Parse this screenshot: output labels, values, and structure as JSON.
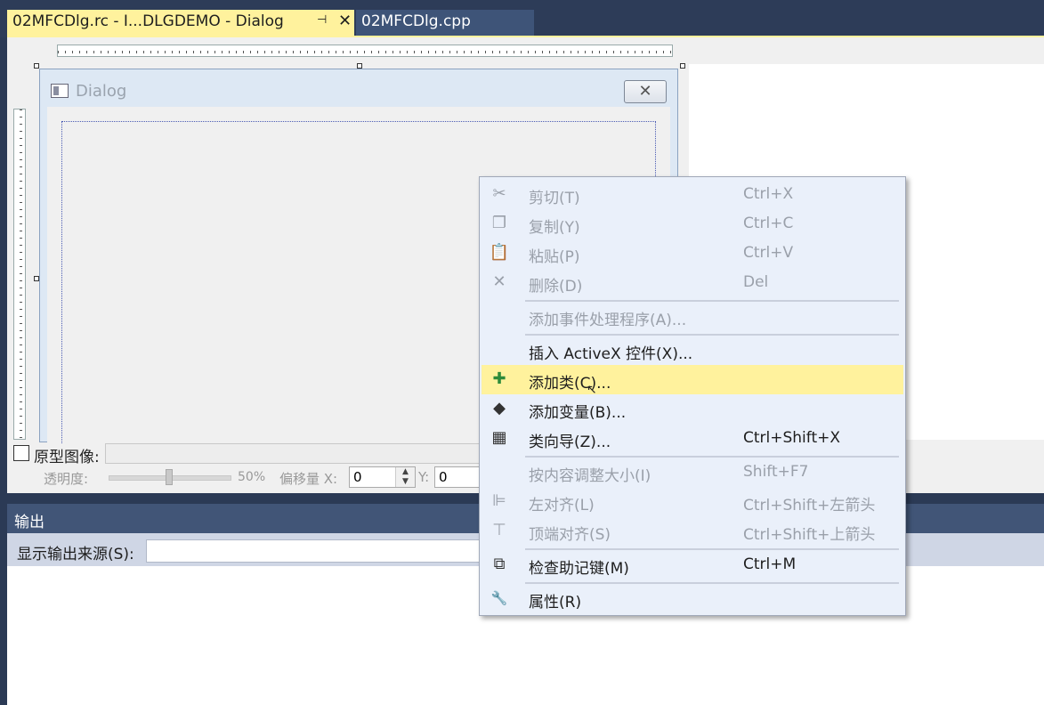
{
  "tabs": [
    {
      "label": "02MFCDlg.rc - I...DLGDEMO - Dialog",
      "active": true
    },
    {
      "label": "02MFCDlg.cpp",
      "active": false
    }
  ],
  "dialog": {
    "title": "Dialog",
    "close_icon": "✕"
  },
  "design_bar": {
    "prototype_label": "原型图像:",
    "opacity_label": "透明度:",
    "opacity_value": "50%",
    "opacity_fraction": 0.5,
    "offset_x_label": "偏移量 X:",
    "offset_x_value": "0",
    "offset_y_label": "Y:",
    "offset_y_value": "0"
  },
  "output": {
    "title": "输出",
    "source_label": "显示输出来源(S):"
  },
  "context_menu": [
    {
      "label": "剪切(T)",
      "shortcut": "Ctrl+X",
      "icon": "scissors-icon",
      "glyph": "✂",
      "enabled": false
    },
    {
      "label": "复制(Y)",
      "shortcut": "Ctrl+C",
      "icon": "copy-icon",
      "glyph": "❐",
      "enabled": false
    },
    {
      "label": "粘贴(P)",
      "shortcut": "Ctrl+V",
      "icon": "paste-icon",
      "glyph": "📋",
      "enabled": false
    },
    {
      "label": "删除(D)",
      "shortcut": "Del",
      "icon": "delete-icon",
      "glyph": "✕",
      "enabled": false
    },
    {
      "label": "添加事件处理程序(A)...",
      "shortcut": "",
      "icon": "",
      "glyph": "",
      "enabled": false
    },
    {
      "label": "插入 ActiveX 控件(X)...",
      "shortcut": "",
      "icon": "",
      "glyph": "",
      "enabled": true
    },
    {
      "label": "添加类(C)...",
      "shortcut": "",
      "icon": "add-class-icon",
      "glyph": "✚",
      "enabled": true,
      "highlighted": true
    },
    {
      "label": "添加变量(B)...",
      "shortcut": "",
      "icon": "add-variable-icon",
      "glyph": "◆",
      "enabled": true
    },
    {
      "label": "类向导(Z)...",
      "shortcut": "Ctrl+Shift+X",
      "icon": "class-wizard-icon",
      "glyph": "▦",
      "enabled": true
    },
    {
      "label": "按内容调整大小(I)",
      "shortcut": "Shift+F7",
      "icon": "",
      "glyph": "",
      "enabled": false
    },
    {
      "label": "左对齐(L)",
      "shortcut": "Ctrl+Shift+左箭头",
      "icon": "align-left-icon",
      "glyph": "⊫",
      "enabled": false
    },
    {
      "label": "顶端对齐(S)",
      "shortcut": "Ctrl+Shift+上箭头",
      "icon": "align-top-icon",
      "glyph": "⊤",
      "enabled": false
    },
    {
      "label": "检查助记键(M)",
      "shortcut": "Ctrl+M",
      "icon": "check-mnemonics-icon",
      "glyph": "⧉",
      "enabled": true
    },
    {
      "label": "属性(R)",
      "shortcut": "",
      "icon": "wrench-icon",
      "glyph": "🔧",
      "enabled": true
    }
  ]
}
